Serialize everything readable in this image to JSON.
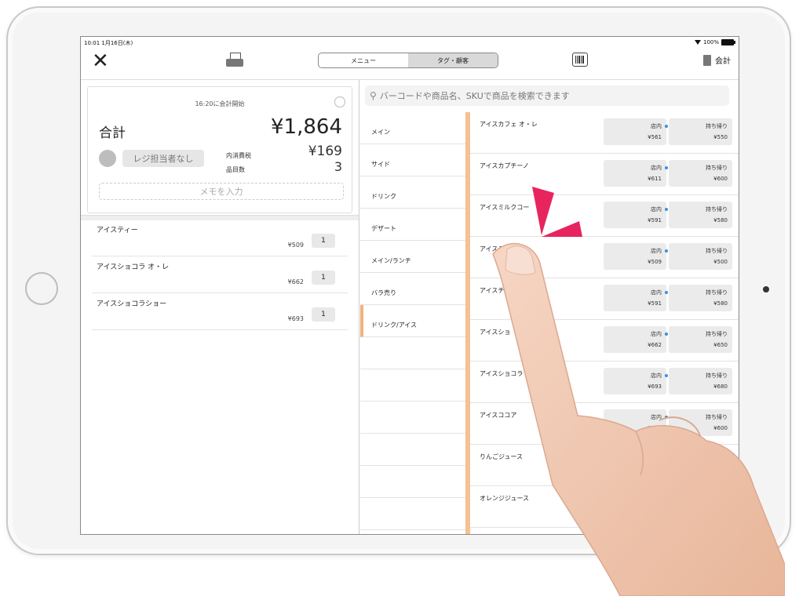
{
  "status_bar": {
    "time": "10:01  1月16日(木)",
    "battery": "100%"
  },
  "nav": {
    "tabs": [
      {
        "label": "メニュー"
      },
      {
        "label": "タグ・顧客"
      }
    ],
    "register_label": "会計"
  },
  "summary": {
    "started": "16:20に会計開始",
    "total_label": "合計",
    "total_value": "¥1,864",
    "staff_button": "レジ担当者なし",
    "tax_label": "内消費税",
    "tax_value": "¥169",
    "count_label": "品目数",
    "count_value": "3",
    "memo_placeholder": "メモを入力"
  },
  "order_items": [
    {
      "name": "アイスティー",
      "price": "¥509",
      "qty": "1"
    },
    {
      "name": "アイスショコラ オ・レ",
      "price": "¥662",
      "qty": "1"
    },
    {
      "name": "アイスショコラショー",
      "price": "¥693",
      "qty": "1"
    }
  ],
  "search": {
    "placeholder": "バーコードや商品名、SKUで商品を検索できます"
  },
  "categories": [
    {
      "label": "メイン"
    },
    {
      "label": "サイド"
    },
    {
      "label": "ドリンク"
    },
    {
      "label": "デザート"
    },
    {
      "label": "メイン/ランチ"
    },
    {
      "label": "バラ売り"
    },
    {
      "label": "ドリンク/アイス",
      "active": true
    }
  ],
  "products": [
    {
      "name": "アイスカフェ オ・レ",
      "dine_in_label": "店内",
      "dine_in_price": "¥561",
      "takeout_label": "持ち帰り",
      "takeout_price": "¥550"
    },
    {
      "name": "アイスカプチーノ",
      "dine_in_label": "店内",
      "dine_in_price": "¥611",
      "takeout_label": "持ち帰り",
      "takeout_price": "¥600"
    },
    {
      "name": "アイスミルクコー",
      "dine_in_label": "店内",
      "dine_in_price": "¥591",
      "takeout_label": "持ち帰り",
      "takeout_price": "¥580"
    },
    {
      "name": "アイステ",
      "dine_in_label": "店内",
      "dine_in_price": "¥509",
      "takeout_label": "持ち帰り",
      "takeout_price": "¥500"
    },
    {
      "name": "アイスチ",
      "dine_in_label": "店内",
      "dine_in_price": "¥591",
      "takeout_label": "持ち帰り",
      "takeout_price": "¥580"
    },
    {
      "name": "アイスショ",
      "dine_in_label": "店内",
      "dine_in_price": "¥662",
      "takeout_label": "持ち帰り",
      "takeout_price": "¥650"
    },
    {
      "name": "アイスショコラ",
      "dine_in_label": "店内",
      "dine_in_price": "¥693",
      "takeout_label": "持ち帰り",
      "takeout_price": "¥680"
    },
    {
      "name": "アイスココア",
      "dine_in_label": "店内",
      "dine_in_price": "¥611",
      "takeout_label": "持ち帰り",
      "takeout_price": "¥600"
    },
    {
      "name": "りんごジュース",
      "dine_in_label": "店内",
      "dine_in_price": "",
      "takeout_label": "り",
      "takeout_price": ""
    },
    {
      "name": "オレンジジュース",
      "dine_in_label": "",
      "dine_in_price": "",
      "takeout_label": "",
      "takeout_price": ""
    }
  ],
  "colors": {
    "accent": "#f3c193",
    "dot": "#3b8ee5",
    "spark": "#e8245e",
    "skin": "#f2c9b3"
  }
}
